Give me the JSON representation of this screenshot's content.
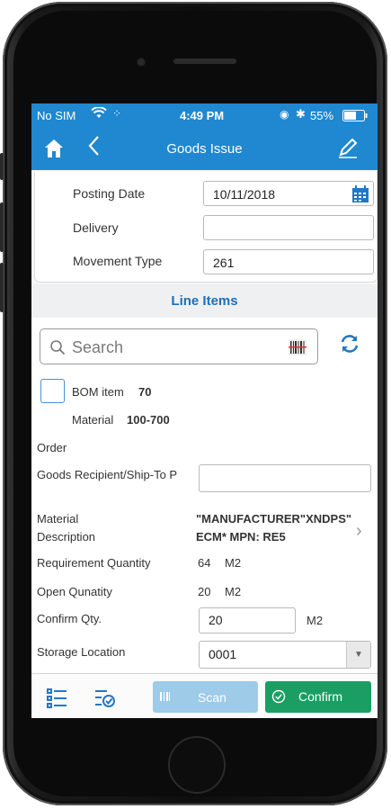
{
  "status": {
    "carrier": "No SIM",
    "time": "4:49 PM",
    "battery": "55%"
  },
  "nav": {
    "title": "Goods Issue"
  },
  "header_fields": [
    {
      "label": "Posting Date",
      "value": "10/11/2018"
    },
    {
      "label": "Delivery",
      "value": ""
    },
    {
      "label": "Movement Type",
      "value": "261"
    }
  ],
  "section_title": "Line Items",
  "search": {
    "placeholder": "Search"
  },
  "item": {
    "bom_label": "BOM item",
    "bom_value": "70",
    "material_label": "Material",
    "material_value": "100-700",
    "order_label": "Order",
    "recipient_label": "Goods Recipient/Ship-To P",
    "recipient_value": "",
    "desc_label": "Material Description",
    "desc_value": "\"MANUFACTURER\"XNDPS\" ECM* MPN: RE5",
    "req_label": "Requirement Quantity",
    "req_qty": "64",
    "req_unit": "M2",
    "open_label": "Open Qunatity",
    "open_qty": "20",
    "open_unit": "M2",
    "confirm_label": "Confirm Qty.",
    "confirm_value": "20",
    "confirm_unit": "M2",
    "storage_label": "Storage Location",
    "storage_value": "0001"
  },
  "footer": {
    "scan_label": "Scan",
    "confirm_label": "Confirm"
  },
  "colors": {
    "brand": "#1f88d0",
    "confirm": "#1a9e63",
    "scan": "#9dcbe8"
  }
}
